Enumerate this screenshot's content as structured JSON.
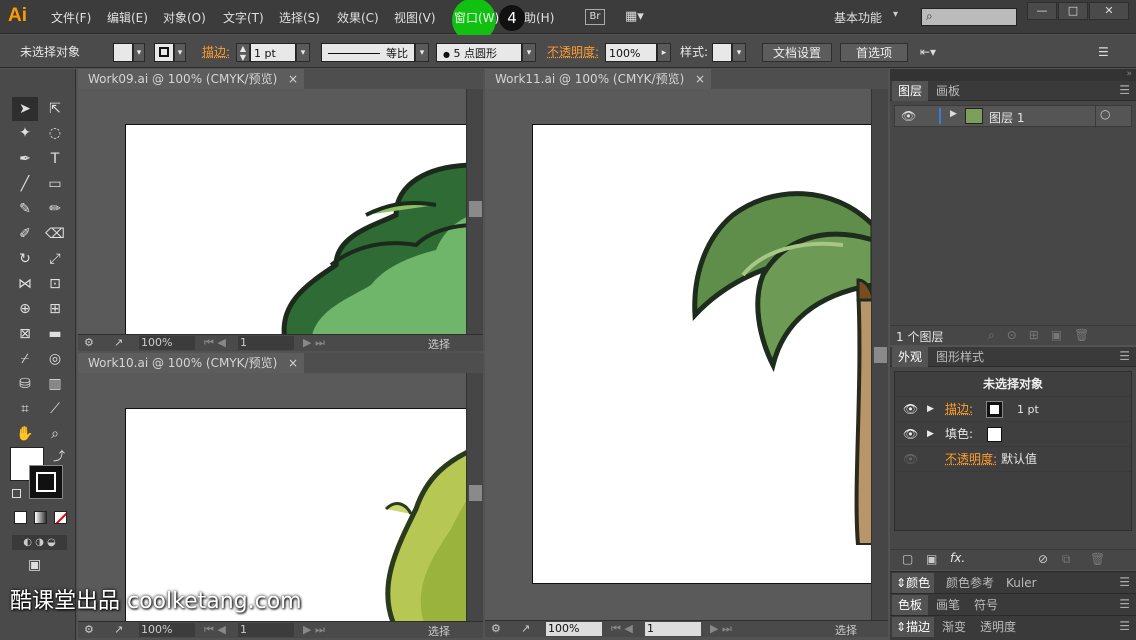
{
  "menubar": {
    "logo": "Ai",
    "items": [
      "文件(F)",
      "编辑(E)",
      "对象(O)",
      "文字(T)",
      "选择(S)",
      "效果(C)",
      "视图(V)",
      "窗口(W)",
      "帮助(H)"
    ],
    "bridge": "Br",
    "workspace": "基本功能",
    "click_badge": "4"
  },
  "controlbar": {
    "selection": "未选择对象",
    "stroke_label": "描边:",
    "stroke_weight": "1 pt",
    "profile": "等比",
    "brush": "5 点圆形",
    "opacity_label": "不透明度:",
    "opacity": "100%",
    "style_label": "样式:",
    "doc_setup": "文档设置",
    "preferences": "首选项"
  },
  "docs": {
    "doc1": {
      "title": "Work09.ai @ 100% (CMYK/预览)",
      "zoom": "100%",
      "page": "1",
      "status": "选择"
    },
    "doc2": {
      "title": "Work10.ai @ 100% (CMYK/预览)",
      "zoom": "100%",
      "page": "1",
      "status": "选择"
    },
    "doc3": {
      "title": "Work11.ai @ 100% (CMYK/预览)",
      "zoom": "100%",
      "page": "1",
      "status": "选择"
    },
    "close_glyph": "×"
  },
  "layers": {
    "tabs": [
      "图层",
      "画板"
    ],
    "layer_name": "图层 1",
    "count": "1 个图层"
  },
  "appearance": {
    "tabs": [
      "外观",
      "图形样式"
    ],
    "header": "未选择对象",
    "stroke_label": "描边:",
    "stroke_value": "1 pt",
    "fill_label": "填色:",
    "opacity_label": "不透明度:",
    "opacity_value": "默认值",
    "fx": "fx."
  },
  "collapsed_panels": [
    [
      "颜色",
      "颜色参考",
      "Kuler"
    ],
    [
      "色板",
      "画笔",
      "符号"
    ],
    [
      "描边",
      "渐变",
      "透明度"
    ]
  ],
  "watermark": "酷课堂出品 coolketang.com",
  "colors": {
    "accent": "#ff9d2e",
    "bg": "#535353",
    "leaf_dark": "#2f6b35",
    "leaf_light": "#8cc063"
  }
}
